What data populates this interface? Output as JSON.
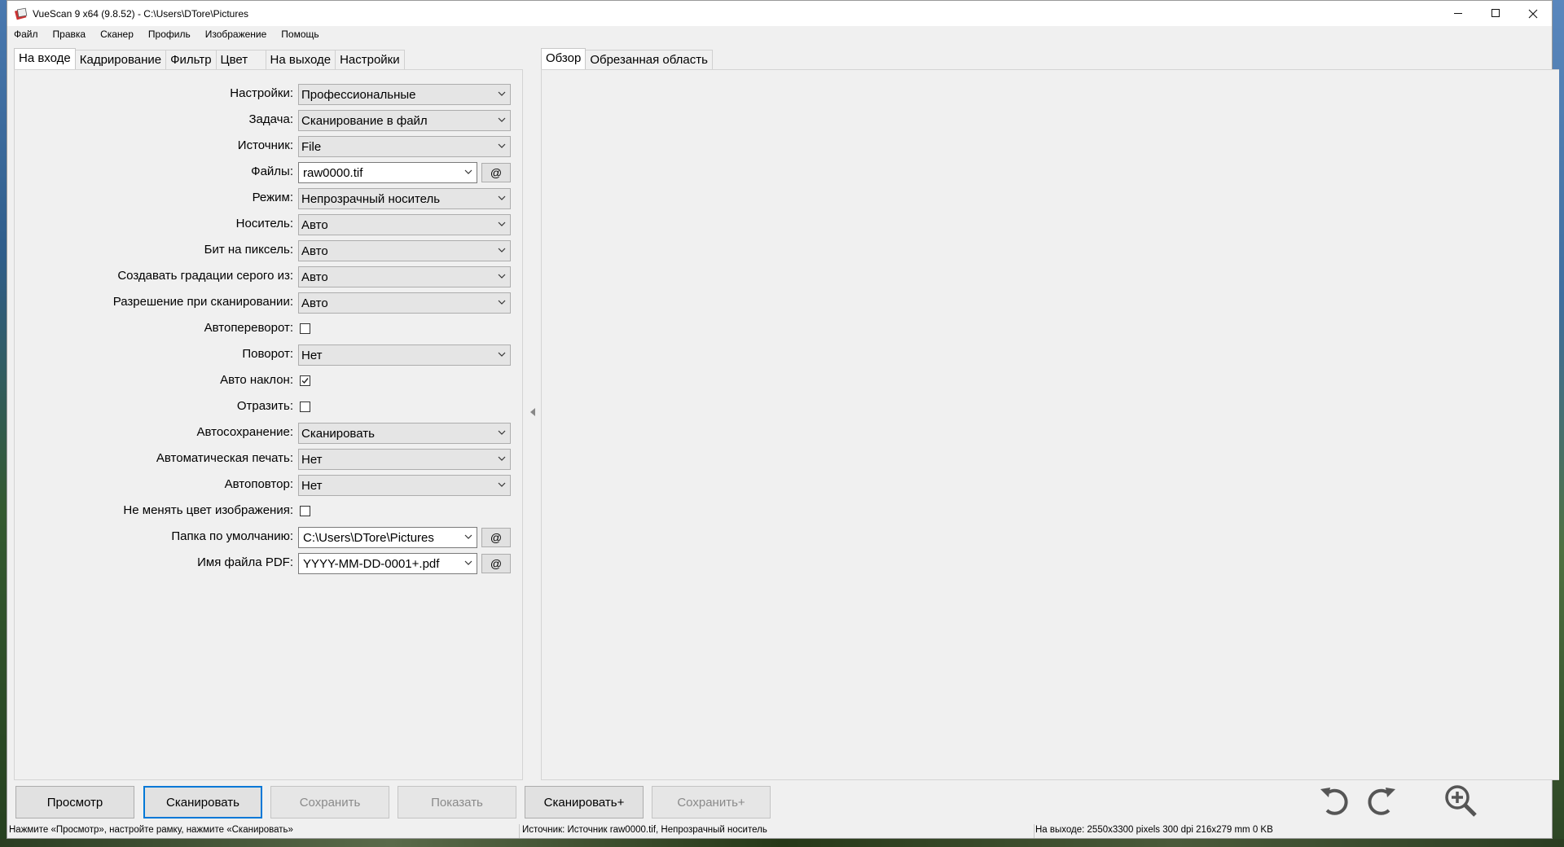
{
  "window": {
    "title": "VueScan 9 x64 (9.8.52) - C:\\Users\\DTore\\Pictures",
    "controls": {
      "minimize": "—",
      "maximize": "☐",
      "close": "✕"
    }
  },
  "menu": [
    "Файл",
    "Правка",
    "Сканер",
    "Профиль",
    "Изображение",
    "Помощь"
  ],
  "left_tabs": [
    "На входе",
    "Кадрирование",
    "Фильтр",
    "Цвет",
    "На выходе",
    "Настройки"
  ],
  "right_tabs": [
    "Обзор",
    "Обрезанная область"
  ],
  "form": {
    "settings": {
      "label": "Настройки:",
      "value": "Профессиональные"
    },
    "task": {
      "label": "Задача:",
      "value": "Сканирование в файл"
    },
    "source": {
      "label": "Источник:",
      "value": "File"
    },
    "files": {
      "label": "Файлы:",
      "value": "raw0000.tif",
      "button": "@"
    },
    "mode": {
      "label": "Режим:",
      "value": "Непрозрачный носитель"
    },
    "media": {
      "label": "Носитель:",
      "value": "Авто"
    },
    "bits": {
      "label": "Бит на пиксель:",
      "value": "Авто"
    },
    "grayscale": {
      "label": "Создавать градации серого из:",
      "value": "Авто"
    },
    "resolution": {
      "label": "Разрешение при сканировании:",
      "value": "Авто"
    },
    "auto_flip": {
      "label": "Автопереворот:",
      "checked": false
    },
    "rotation": {
      "label": "Поворот:",
      "value": "Нет"
    },
    "auto_skew": {
      "label": "Авто наклон:",
      "checked": true
    },
    "mirror": {
      "label": "Отразить:",
      "checked": false
    },
    "auto_save": {
      "label": "Автосохранение:",
      "value": "Сканировать"
    },
    "auto_print": {
      "label": "Автоматическая печать:",
      "value": "Нет"
    },
    "auto_repeat": {
      "label": "Автоповтор:",
      "value": "Нет"
    },
    "keep_color": {
      "label": "Не менять цвет изображения:",
      "checked": false
    },
    "default_folder": {
      "label": "Папка по умолчанию:",
      "value": "C:\\Users\\DTore\\Pictures",
      "button": "@"
    },
    "pdf_name": {
      "label": "Имя файла PDF:",
      "value": "YYYY-MM-DD-0001+.pdf",
      "button": "@"
    }
  },
  "buttons": {
    "preview": "Просмотр",
    "scan": "Сканировать",
    "save": "Сохранить",
    "show": "Показать",
    "scan_plus": "Сканировать+",
    "save_plus": "Сохранить+"
  },
  "status": {
    "hint": "Нажмите «Просмотр», настройте рамку, нажмите «Сканировать»",
    "input": "Источник: Источник raw0000.tif, Непрозрачный носитель",
    "output": "На выходе: 2550x3300 pixels 300 dpi 216x279 mm 0 KB"
  },
  "colors": {
    "accent": "#0078d7",
    "window_bg": "#f0f0f0",
    "button_bg": "#e1e1e1"
  }
}
